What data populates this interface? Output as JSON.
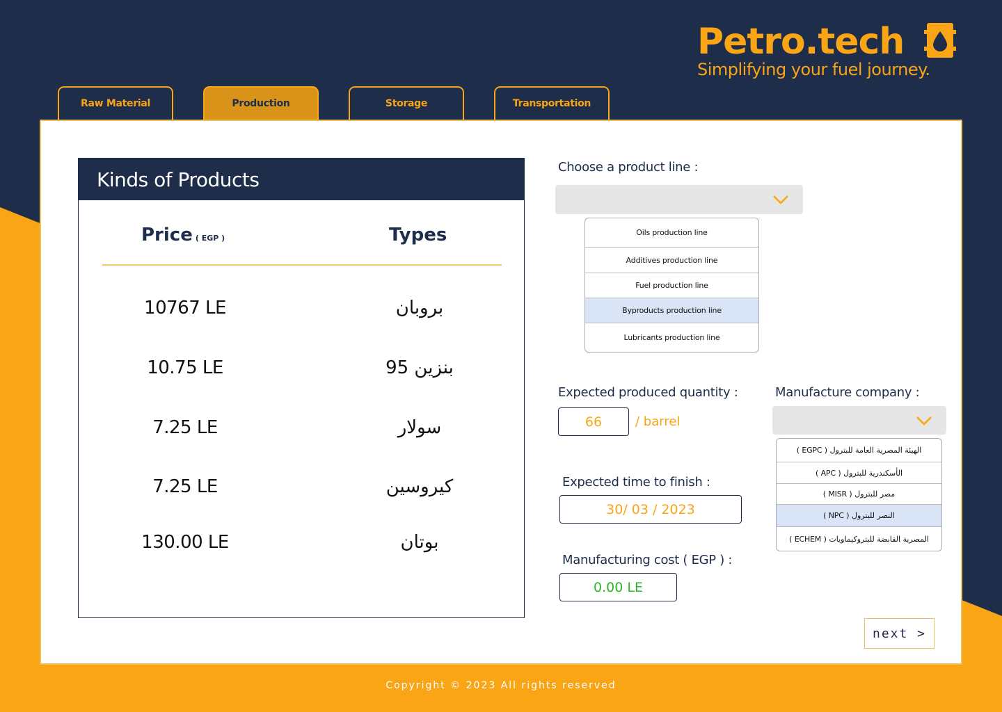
{
  "brand": {
    "name": "Petro.tech",
    "tagline": "Simplifying your fuel journey.",
    "logo_icon": "fuel-drop-icon"
  },
  "colors": {
    "navy": "#1e2d4a",
    "orange": "#f9a515",
    "green": "#2bb52b",
    "highlight": "#d9e4f7"
  },
  "tabs": [
    {
      "label": "Raw Material",
      "active": false
    },
    {
      "label": "Production",
      "active": true
    },
    {
      "label": "Storage",
      "active": false
    },
    {
      "label": "Transportation",
      "active": false
    }
  ],
  "products": {
    "title": "Kinds of Products",
    "price_header": "Price",
    "price_unit": "( EGP )",
    "types_header": "Types",
    "rows": [
      {
        "price": "10767 LE",
        "type": "بروبان"
      },
      {
        "price": "10.75 LE",
        "type": "بنزين 95"
      },
      {
        "price": "7.25 LE",
        "type": "سولار"
      },
      {
        "price": "7.25 LE",
        "type": "كيروسين"
      },
      {
        "price": "130.00 LE",
        "type": "بوتان"
      }
    ]
  },
  "product_line": {
    "label": "Choose a product line :",
    "selected": "",
    "options": [
      {
        "label": "Oils production line",
        "highlighted": false
      },
      {
        "label": "Additives production line",
        "highlighted": false
      },
      {
        "label": "Fuel production line",
        "highlighted": false
      },
      {
        "label": "Byproducts production line",
        "highlighted": true
      },
      {
        "label": "Lubricants production line",
        "highlighted": false
      }
    ]
  },
  "quantity": {
    "label": "Expected produced quantity :",
    "value": "66",
    "unit": "/ barrel"
  },
  "company": {
    "label": "Manufacture company :",
    "selected": "",
    "options": [
      {
        "label": "الهيئة المصرية العامة للبترول ( EGPC )",
        "highlighted": false
      },
      {
        "label": "الأسكندرية للبترول ( APC )",
        "highlighted": false
      },
      {
        "label": "مصر للبترول ( MISR )",
        "highlighted": false
      },
      {
        "label": "النصر للبترول ( NPC )",
        "highlighted": true
      },
      {
        "label": "المصرية القابضة للبتروكيماويات ( ECHEM )",
        "highlighted": false
      }
    ]
  },
  "finish_time": {
    "label": "Expected time to finish :",
    "value": "30/ 03 / 2023"
  },
  "cost": {
    "label": "Manufacturing cost ( EGP ) :",
    "value": "0.00 LE"
  },
  "next_button": "next >",
  "footer": "Copyright © 2023 All rights reserved"
}
